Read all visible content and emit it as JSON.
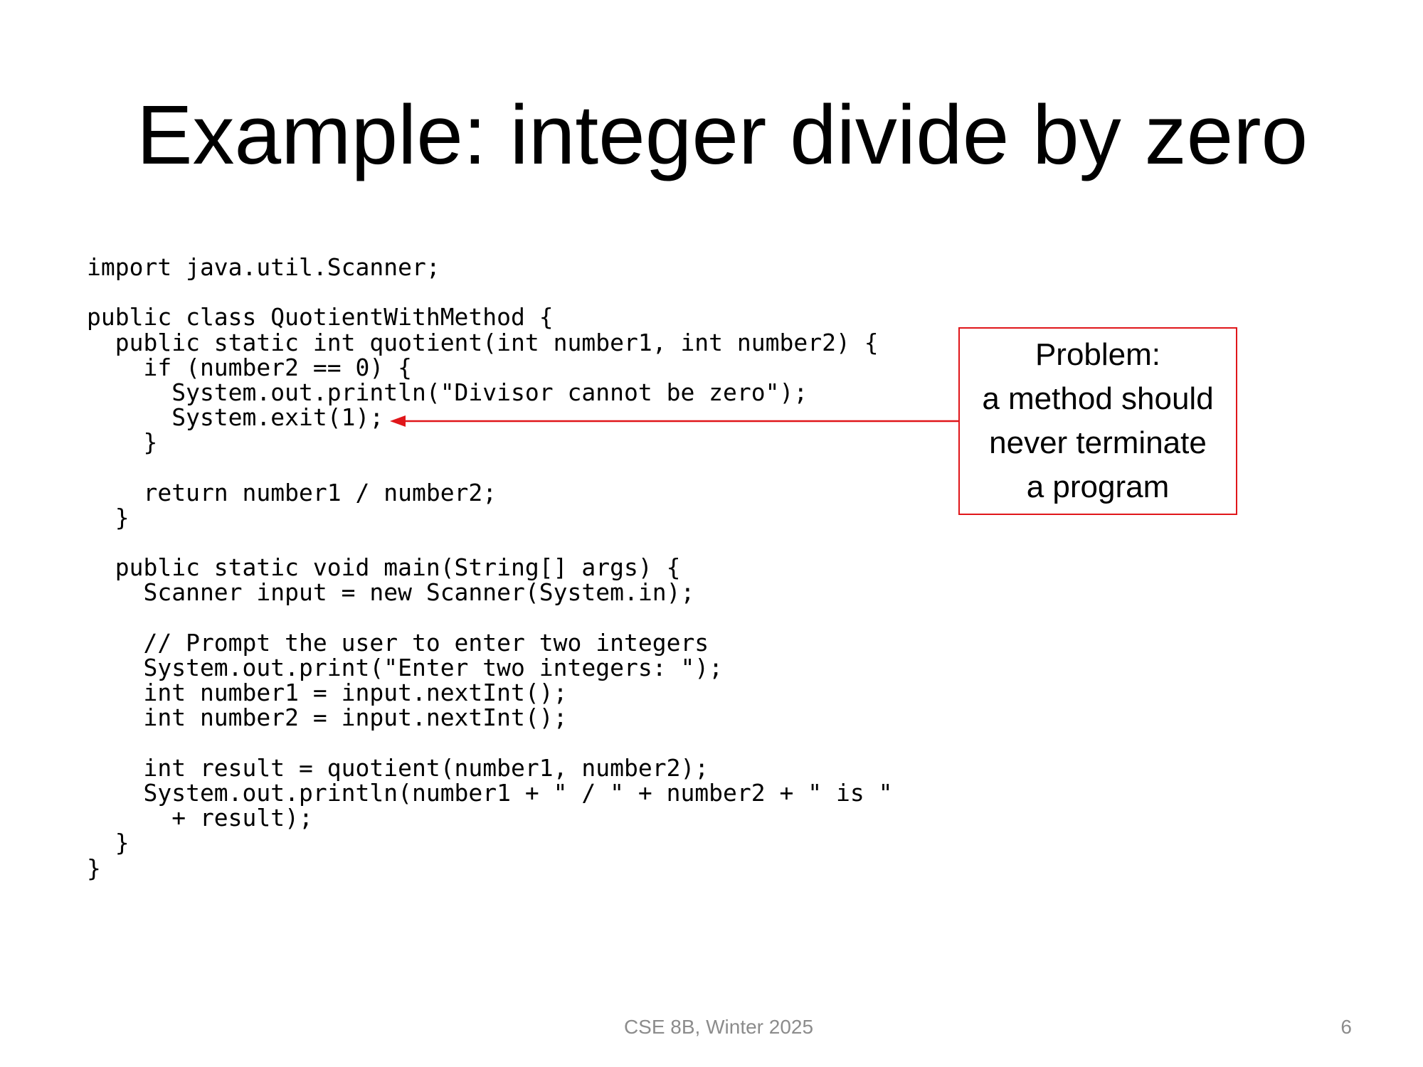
{
  "slide": {
    "title": "Example: integer divide by zero",
    "code_lines": [
      "import java.util.Scanner;",
      "",
      "public class QuotientWithMethod {",
      "  public static int quotient(int number1, int number2) {",
      "    if (number2 == 0) {",
      "      System.out.println(\"Divisor cannot be zero\");",
      "      System.exit(1);",
      "    }",
      "",
      "    return number1 / number2;",
      "  }",
      "",
      "  public static void main(String[] args) {",
      "    Scanner input = new Scanner(System.in);",
      "",
      "    // Prompt the user to enter two integers",
      "    System.out.print(\"Enter two integers: \");",
      "    int number1 = input.nextInt();",
      "    int number2 = input.nextInt();",
      "",
      "    int result = quotient(number1, number2);",
      "    System.out.println(number1 + \" / \" + number2 + \" is \"",
      "      + result);",
      "  }",
      "}"
    ],
    "callout_lines": [
      "Problem:",
      "a method should",
      "never terminate",
      "a program"
    ],
    "footer": "CSE 8B, Winter 2025",
    "slide_number": "6",
    "colors": {
      "callout_border": "#e0161a",
      "arrow": "#e0161a",
      "footer_text": "#8c8c8c"
    }
  }
}
